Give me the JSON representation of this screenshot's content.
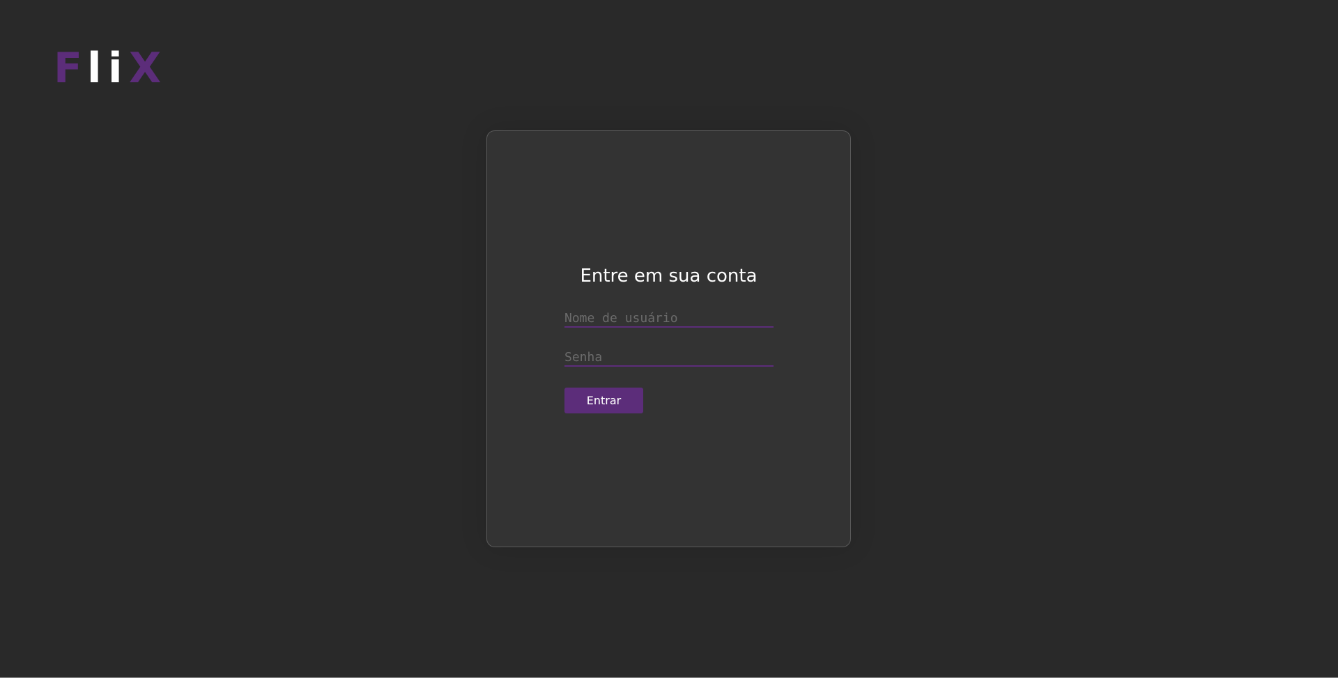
{
  "brand": {
    "letters": [
      "F",
      "l",
      "i",
      "X"
    ],
    "colors": [
      "#5c2d7a",
      "#ffffff",
      "#ffffff",
      "#5c2d7a"
    ]
  },
  "login": {
    "title": "Entre em sua conta",
    "username_placeholder": "Nome de usuário",
    "password_placeholder": "Senha",
    "submit_label": "Entrar"
  },
  "theme": {
    "background": "#292929",
    "card": "#333333",
    "accent": "#5c2d7a"
  }
}
